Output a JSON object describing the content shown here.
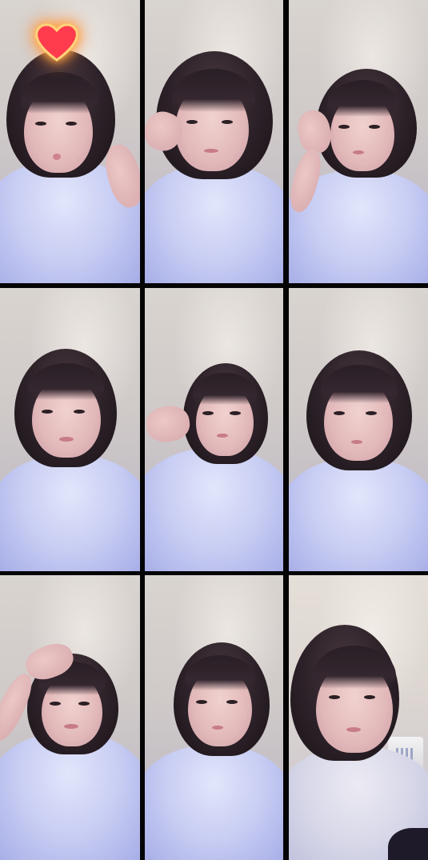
{
  "image": {
    "layout": "3x3 photo grid",
    "frame_count": 9,
    "colors": {
      "background": "#050505",
      "sweater": "#c8cdf3",
      "hair": "#2c2128",
      "wall": "#d4cfcb",
      "heart_fill": "#ff3b4e",
      "heart_glow": "#ffb347"
    },
    "frames": [
      {
        "name": "frame-1",
        "overlay_icon": "heart-icon"
      },
      {
        "name": "frame-2"
      },
      {
        "name": "frame-3"
      },
      {
        "name": "frame-4"
      },
      {
        "name": "frame-5"
      },
      {
        "name": "frame-6"
      },
      {
        "name": "frame-7"
      },
      {
        "name": "frame-8"
      },
      {
        "name": "frame-9"
      }
    ]
  }
}
